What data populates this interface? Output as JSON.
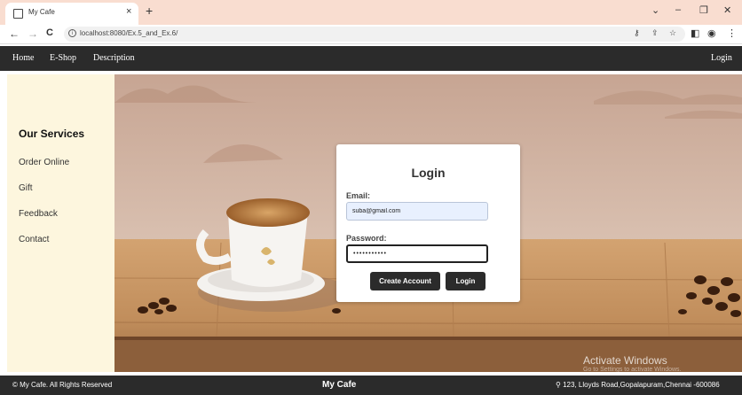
{
  "browser": {
    "tab_title": "My Cafe",
    "tab_close": "×",
    "new_tab": "+",
    "url": "localhost:8080/Ex.5_and_Ex.6/",
    "controls": {
      "dropdown": "⌄",
      "minimize": "–",
      "maximize": "❐",
      "close": "✕"
    },
    "nav": {
      "back": "←",
      "forward": "→",
      "reload": "C"
    }
  },
  "nav": {
    "items": [
      "Home",
      "E-Shop",
      "Description"
    ],
    "login_label": "Login"
  },
  "sidebar": {
    "title": "Our Services",
    "items": [
      "Order Online",
      "Gift",
      "Feedback",
      "Contact"
    ]
  },
  "login_form": {
    "title": "Login",
    "email_label": "Email:",
    "email_value": "suba@gmail.com",
    "password_label": "Password:",
    "password_value": "•••••••••••",
    "create_account_label": "Create Account",
    "login_button_label": "Login"
  },
  "watermark": {
    "title": "Activate Windows",
    "subtitle": "Go to Settings to activate Windows."
  },
  "footer": {
    "copyright": "© My Cafe. All Rights Reserved",
    "brand": "My Cafe",
    "address": "123, Lloyds Road,Gopalapuram,Chennai -600086"
  },
  "colors": {
    "nav_bg": "#2b2b2b",
    "sidebar_bg": "#fdf6de",
    "tab_strip_bg": "#f9ddd0",
    "email_autofill_bg": "#e8f0fe"
  }
}
